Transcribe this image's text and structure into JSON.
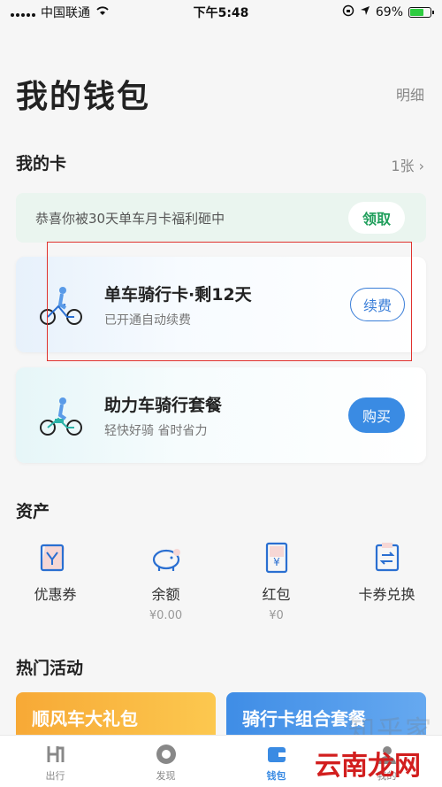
{
  "status_bar": {
    "carrier": "中国联通",
    "time": "下午5:48",
    "battery": "69%"
  },
  "header": {
    "title": "我的钱包",
    "detail": "明细"
  },
  "cards_section": {
    "title": "我的卡",
    "count": "1张 ›"
  },
  "promo": {
    "text": "恭喜你被30天单车月卡福利砸中",
    "button": "领取"
  },
  "cards": [
    {
      "title": "单车骑行卡·剩12天",
      "subtitle": "已开通自动续费",
      "button": "续费"
    },
    {
      "title": "助力车骑行套餐",
      "subtitle": "轻快好骑 省时省力",
      "button": "购买"
    }
  ],
  "assets_section": {
    "title": "资产",
    "items": [
      {
        "label": "优惠券",
        "value": "",
        "icon": "coupon-icon"
      },
      {
        "label": "余额",
        "value": "¥0.00",
        "icon": "piggy-bank-icon"
      },
      {
        "label": "红包",
        "value": "¥0",
        "icon": "red-packet-icon"
      },
      {
        "label": "卡券兑换",
        "value": "",
        "icon": "exchange-icon"
      }
    ]
  },
  "activities_section": {
    "title": "热门活动",
    "items": [
      "顺风车大礼包",
      "骑行卡组合套餐"
    ]
  },
  "tabbar": {
    "items": [
      {
        "label": "出行",
        "icon": "ride-icon"
      },
      {
        "label": "发现",
        "icon": "discover-icon"
      },
      {
        "label": "钱包",
        "icon": "wallet-icon"
      },
      {
        "label": "我的",
        "icon": "profile-icon"
      }
    ]
  },
  "watermarks": [
    "知乎家",
    "云南龙网"
  ],
  "colors": {
    "accent": "#3a8be3",
    "green": "#1f9e5b",
    "highlight": "#e0322e"
  }
}
